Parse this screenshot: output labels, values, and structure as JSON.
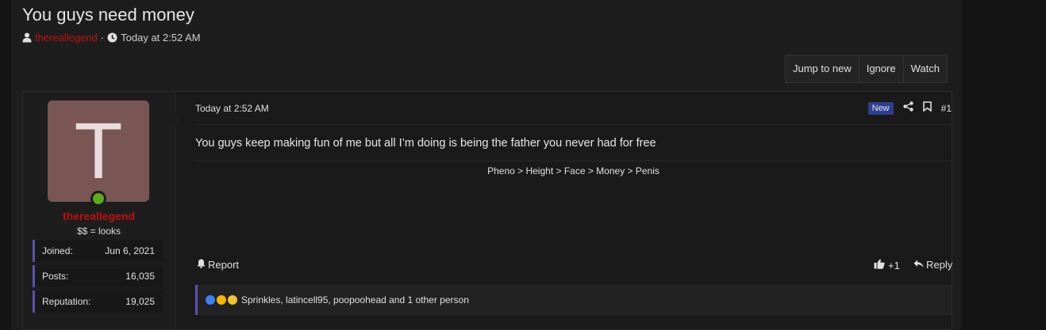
{
  "thread": {
    "title": "You guys need money",
    "author": "thereallegend",
    "separator": "·",
    "time": "Today at 2:52 AM"
  },
  "actions": {
    "jump_to_new": "Jump to new",
    "ignore": "Ignore",
    "watch": "Watch"
  },
  "user": {
    "avatar_letter": "T",
    "name": "thereallegend",
    "title": "$$ = looks",
    "stats": [
      {
        "label": "Joined:",
        "value": "Jun 6, 2021"
      },
      {
        "label": "Posts:",
        "value": "16,035"
      },
      {
        "label": "Reputation:",
        "value": "19,025"
      }
    ],
    "online_color": "#5fa818"
  },
  "post": {
    "time": "Today at 2:52 AM",
    "badge": "New",
    "number": "#1",
    "body": "You guys keep making fun of me but all I’m doing is being the father you never had for free",
    "signature": "Pheno > Height > Face > Money > Penis",
    "report": "Report",
    "like_count": "+1",
    "reply": "Reply",
    "reactions_text": "Sprinkles, latincell95, poopoohead and 1 other person"
  },
  "colors": {
    "accent_red": "#c21010",
    "accent_purple": "#5a51b0",
    "badge_blue": "#2d3f8c"
  }
}
